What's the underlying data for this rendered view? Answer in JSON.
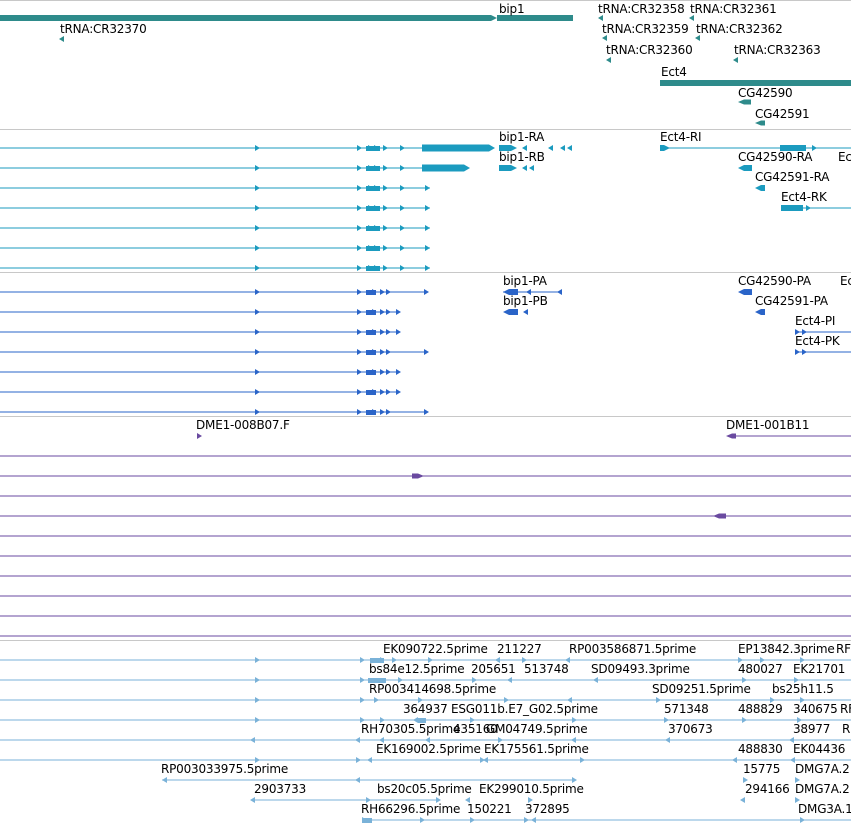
{
  "colors": {
    "gene": "#2e8b8b",
    "transcript": "#1b9bbf",
    "protein": "#2a64c8",
    "clone": "#6a4aa0",
    "est": "#7ab2d8",
    "separator": "#c8c8c8"
  },
  "tracks": {
    "genes": [
      "bip1",
      "tRNA:CR32370",
      "tRNA:CR32358",
      "tRNA:CR32361",
      "tRNA:CR32359",
      "tRNA:CR32362",
      "tRNA:CR32360",
      "tRNA:CR32363",
      "Ect4",
      "CG42590",
      "CG42591"
    ],
    "transcripts": [
      "bip1-RA",
      "bip1-RB",
      "Ect4-RI",
      "CG42590-RA",
      "Ec",
      "CG42591-RA",
      "Ect4-RK"
    ],
    "proteins": [
      "bip1-PA",
      "bip1-PB",
      "CG42590-PA",
      "Ec",
      "CG42591-PA",
      "Ect4-PI",
      "Ect4-PK"
    ],
    "clones": [
      "DME1-008B07.F",
      "DME1-001B11"
    ],
    "ests": [
      "EK090722.5prime",
      "211227",
      "RP003586871.5prime",
      "EP13842.3prime",
      "RF",
      "bs84e12.5prime",
      "205651",
      "513748",
      "SD09493.3prime",
      "480027",
      "EK21701",
      "RP003414698.5prime",
      "SD09251.5prime",
      "bs25h11.5",
      "364937",
      "ESG011b.E7_G02.5prime",
      "571348",
      "488829",
      "340675",
      "RF",
      "RH70305.5prime",
      "435160",
      "GM04749.5prime",
      "370673",
      "38977",
      "R",
      "EK169002.5prime",
      "EK175561.5prime",
      "488830",
      "EK04436",
      "RP003033975.5prime",
      "15775",
      "DMG7A.2",
      "2903733",
      "bs20c05.5prime",
      "EK299010.5prime",
      "294166",
      "DMG7A.2",
      "RH66296.5prime",
      "150221",
      "372895",
      "DMG3A.1"
    ]
  }
}
